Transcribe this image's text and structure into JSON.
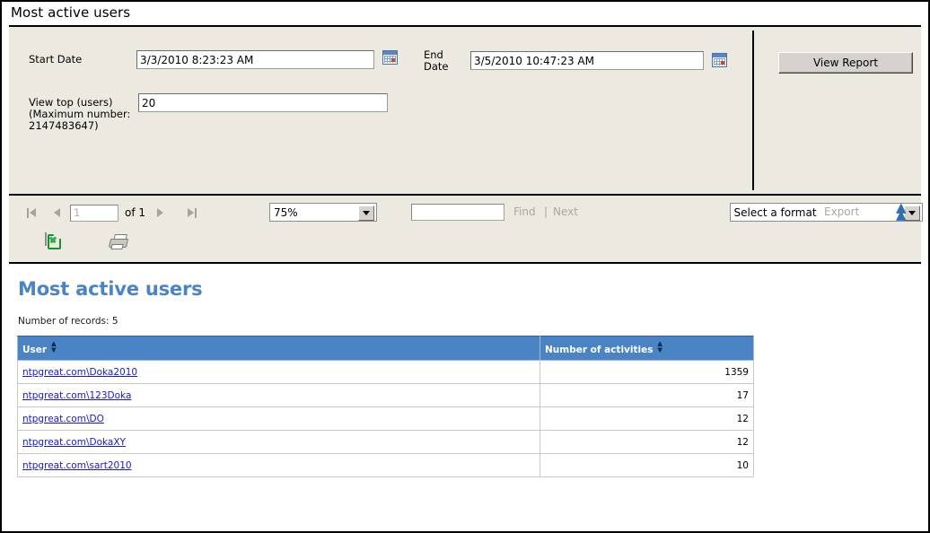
{
  "window": {
    "title": "Most active users"
  },
  "parameters": {
    "start_date": {
      "label": "Start Date",
      "value": "3/3/2010 8:23:23 AM",
      "calendar_icon": "calendar-icon"
    },
    "end_date": {
      "label": "End Date",
      "value": "3/5/2010 10:47:23 AM",
      "calendar_icon": "calendar-icon"
    },
    "view_top": {
      "label": "View top (users) (Maximum number: 2147483647)",
      "value": "20"
    },
    "view_report_button": "View Report"
  },
  "toolbar": {
    "first_page_icon": "first-page-icon",
    "prev_page_icon": "previous-page-icon",
    "next_page_icon": "next-page-icon",
    "last_page_icon": "last-page-icon",
    "page_number": "1",
    "page_of": "of 1",
    "zoom": "75%",
    "find_value": "",
    "find_label": "Find",
    "find_separator": "|",
    "next_label": "Next",
    "export_format": "Select a format",
    "export_label": "Export",
    "collapse_icon": "double-chevron-up-icon",
    "refresh_icon": "refresh-icon",
    "print_icon": "print-icon"
  },
  "report": {
    "title": "Most active users",
    "record_count_text": "Number of records: 5",
    "columns": [
      {
        "label": "User",
        "sort_icon": "sort-toggle-icon"
      },
      {
        "label": "Number of activities",
        "sort_icon": "sort-toggle-icon"
      }
    ],
    "rows": [
      {
        "user": "ntpgreat.com\\Doka2010",
        "activities": "1359"
      },
      {
        "user": "ntpgreat.com\\123Doka",
        "activities": "17"
      },
      {
        "user": "ntpgreat.com\\DO",
        "activities": "12"
      },
      {
        "user": "ntpgreat.com\\DokaXY",
        "activities": "12"
      },
      {
        "user": "ntpgreat.com\\sart2010",
        "activities": "10"
      }
    ]
  },
  "colors": {
    "accent_blue": "#4a84c4",
    "link_blue": "#1818cf",
    "panel_beige": "#ece9e0",
    "chevron_blue": "#2f6fb5"
  }
}
